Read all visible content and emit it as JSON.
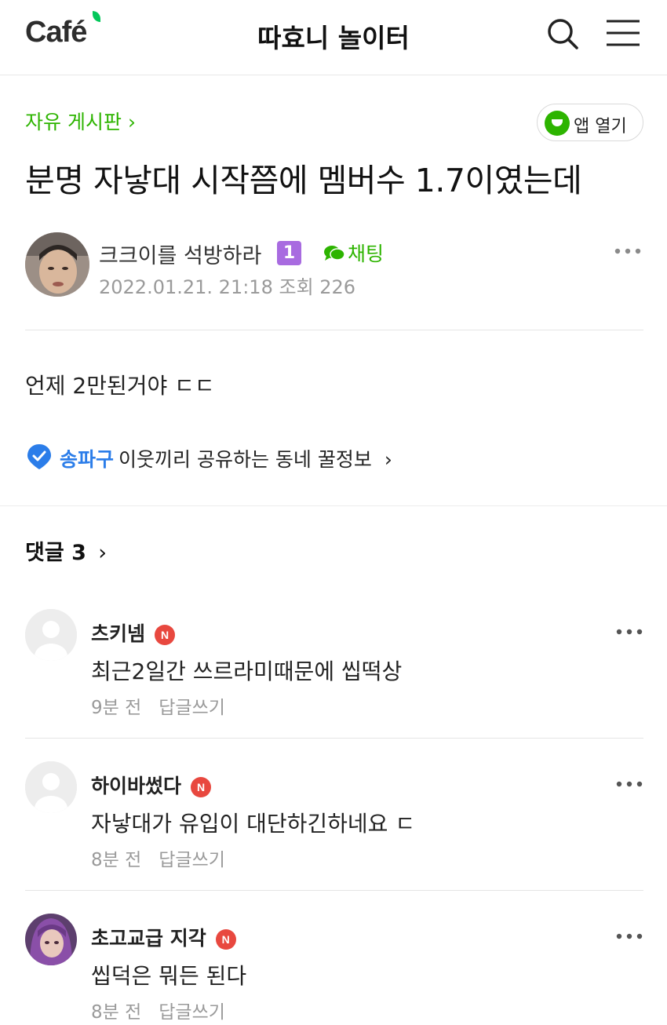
{
  "header": {
    "logo": "Café",
    "cafe_name": "따효니 놀이터"
  },
  "post": {
    "board": "자유 게시판",
    "board_chevron": "›",
    "app_open_label": "앱 열기",
    "title": "분명 자낳대 시작쯤에 멤버수 1.7이였는데",
    "author": "크크이를 석방하라",
    "level": "1",
    "chat_label": "채팅",
    "date": "2022.01.21. 21:18",
    "views_label": "조회 226",
    "body": "언제 2만된거야 ㄷㄷ"
  },
  "local_info": {
    "region": "송파구",
    "text": "이웃끼리 공유하는 동네 꿀정보",
    "chevron": "›"
  },
  "comments_header": {
    "label": "댓글 3",
    "chevron": "›"
  },
  "comments": [
    {
      "name": "츠키넴",
      "badge": "N",
      "text": "최근2일간 쓰르라미때문에 씹떡상",
      "time": "9분 전",
      "reply": "답글쓰기"
    },
    {
      "name": "하이바썼다",
      "badge": "N",
      "text": "자낳대가 유입이 대단하긴하네요 ㄷ",
      "time": "8분 전",
      "reply": "답글쓰기"
    },
    {
      "name": "초고교급 지각",
      "badge": "N",
      "text": "씹덕은 뭐든 된다",
      "time": "8분 전",
      "reply": "답글쓰기"
    }
  ],
  "colors": {
    "brand_green": "#2db400",
    "region_blue": "#2b7de9",
    "new_badge_red": "#e8483f",
    "level_badge_purple": "#a86be0"
  }
}
